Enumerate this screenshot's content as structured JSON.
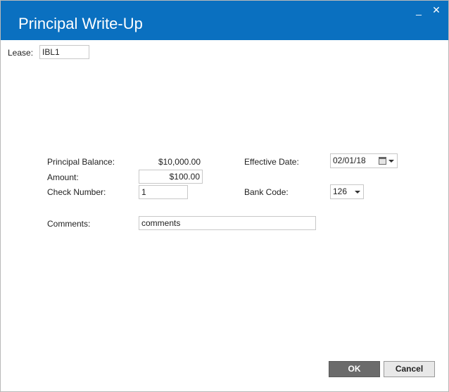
{
  "window": {
    "title": "Principal Write-Up",
    "minimize_glyph": "_",
    "close_glyph": "✕"
  },
  "lease": {
    "label": "Lease:",
    "value": "IBL1"
  },
  "form": {
    "principal_balance": {
      "label": "Principal Balance:",
      "value": "$10,000.00"
    },
    "amount": {
      "label": "Amount:",
      "value": "$100.00"
    },
    "check_number": {
      "label": "Check Number:",
      "value": "1"
    },
    "effective_date": {
      "label": "Effective Date:",
      "value": "02/01/18",
      "icon": "calendar-icon"
    },
    "bank_code": {
      "label": "Bank Code:",
      "value": "126"
    },
    "comments": {
      "label": "Comments:",
      "value": "comments"
    }
  },
  "buttons": {
    "ok": "OK",
    "cancel": "Cancel"
  },
  "colors": {
    "titlebar": "#0a70c0",
    "ok_button": "#6b6b6b",
    "cancel_button": "#e8e8e8"
  }
}
